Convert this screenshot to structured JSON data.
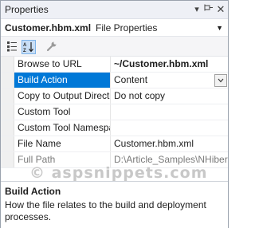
{
  "window": {
    "title": "Properties",
    "dropdown_glyph": "▾",
    "pin_glyph": "⊣",
    "close_glyph": "✕"
  },
  "object_selector": {
    "name": "Customer.hbm.xml",
    "type": "File Properties",
    "caret": "▼"
  },
  "toolbar": {
    "items": [
      {
        "icon": "categorized-icon",
        "active": false
      },
      {
        "icon": "alphabetical-sort-icon",
        "active": true
      },
      {
        "icon": "property-pages-wrench-icon",
        "active": false
      }
    ]
  },
  "grid": {
    "rows": [
      {
        "name": "Browse to URL",
        "value": "~/Customer.hbm.xml",
        "bold": true
      },
      {
        "name": "Build Action",
        "value": "Content",
        "selected": true,
        "has_dropdown": true
      },
      {
        "name": "Copy to Output Directory",
        "value": "Do not copy"
      },
      {
        "name": "Custom Tool",
        "value": ""
      },
      {
        "name": "Custom Tool Namespace",
        "value": ""
      },
      {
        "name": "File Name",
        "value": "Customer.hbm.xml"
      },
      {
        "name": "Full Path",
        "value": "D:\\Article_Samples\\NHibernate",
        "disabled": true
      }
    ],
    "dropdown_glyph": "⌄"
  },
  "watermark": "© aspsnippets.com",
  "description": {
    "title": "Build Action",
    "text": "How the file relates to the build and deployment processes."
  },
  "colors": {
    "selection": "#0078d7",
    "titlebar": "#eef0f6"
  }
}
